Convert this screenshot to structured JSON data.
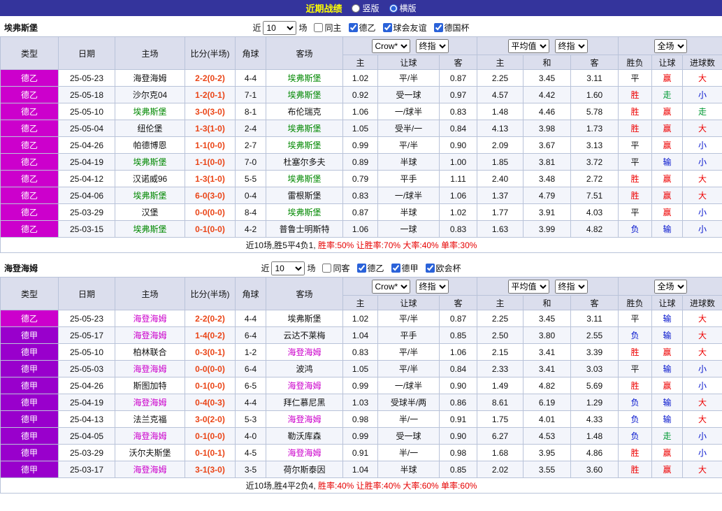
{
  "topbar": {
    "title": "近期战绩",
    "radios": [
      {
        "label": "竖版",
        "checked": false
      },
      {
        "label": "横版",
        "checked": true
      }
    ]
  },
  "league_colors": {
    "德乙": "#cc00cc",
    "德甲": "#9900cc"
  },
  "header_labels": {
    "col_type": "类型",
    "col_date": "日期",
    "col_home": "主场",
    "col_score": "比分(半场)",
    "col_corner": "角球",
    "col_away": "客场",
    "odds_sub": [
      "主",
      "让球",
      "客"
    ],
    "avg_sub": [
      "主",
      "和",
      "客"
    ],
    "result_sub": [
      "胜负",
      "让球",
      "进球数"
    ]
  },
  "sections": [
    {
      "team": "埃弗斯堡",
      "focal_color": "#008800",
      "filter": {
        "prefix": "近",
        "matches": "10",
        "suffix": "场",
        "checkboxes": [
          {
            "label": "同主",
            "checked": false
          },
          {
            "label": "德乙",
            "checked": true
          },
          {
            "label": "球会友谊",
            "checked": true
          },
          {
            "label": "德国杯",
            "checked": true
          }
        ]
      },
      "selects": {
        "bookmaker": "Crow*",
        "odds_stage": "终指",
        "average": "平均值",
        "avg_stage": "终指",
        "scope": "全场"
      },
      "rows": [
        {
          "league": "德乙",
          "date": "25-05-23",
          "home": "海登海姆",
          "home_focal": false,
          "score": "2-2(0-2)",
          "corner": "4-4",
          "away": "埃弗斯堡",
          "away_focal": true,
          "odds": [
            "1.02",
            "平/半",
            "0.87"
          ],
          "avg": [
            "2.25",
            "3.45",
            "3.11"
          ],
          "results": [
            "平",
            "赢",
            "大"
          ]
        },
        {
          "league": "德乙",
          "date": "25-05-18",
          "home": "沙尔克04",
          "home_focal": false,
          "score": "1-2(0-1)",
          "corner": "7-1",
          "away": "埃弗斯堡",
          "away_focal": true,
          "odds": [
            "0.92",
            "受一球",
            "0.97"
          ],
          "avg": [
            "4.57",
            "4.42",
            "1.60"
          ],
          "results": [
            "胜",
            "走",
            "小"
          ]
        },
        {
          "league": "德乙",
          "date": "25-05-10",
          "home": "埃弗斯堡",
          "home_focal": true,
          "score": "3-0(3-0)",
          "corner": "8-1",
          "away": "布伦瑞克",
          "away_focal": false,
          "odds": [
            "1.06",
            "一/球半",
            "0.83"
          ],
          "avg": [
            "1.48",
            "4.46",
            "5.78"
          ],
          "results": [
            "胜",
            "赢",
            "走"
          ]
        },
        {
          "league": "德乙",
          "date": "25-05-04",
          "home": "纽伦堡",
          "home_focal": false,
          "score": "1-3(1-0)",
          "corner": "2-4",
          "away": "埃弗斯堡",
          "away_focal": true,
          "odds": [
            "1.05",
            "受半/一",
            "0.84"
          ],
          "avg": [
            "4.13",
            "3.98",
            "1.73"
          ],
          "results": [
            "胜",
            "赢",
            "大"
          ]
        },
        {
          "league": "德乙",
          "date": "25-04-26",
          "home": "帕德博恩",
          "home_focal": false,
          "score": "1-1(0-0)",
          "corner": "2-7",
          "away": "埃弗斯堡",
          "away_focal": true,
          "odds": [
            "0.99",
            "平/半",
            "0.90"
          ],
          "avg": [
            "2.09",
            "3.67",
            "3.13"
          ],
          "results": [
            "平",
            "赢",
            "小"
          ]
        },
        {
          "league": "德乙",
          "date": "25-04-19",
          "home": "埃弗斯堡",
          "home_focal": true,
          "score": "1-1(0-0)",
          "corner": "7-0",
          "away": "杜塞尔多夫",
          "away_focal": false,
          "odds": [
            "0.89",
            "半球",
            "1.00"
          ],
          "avg": [
            "1.85",
            "3.81",
            "3.72"
          ],
          "results": [
            "平",
            "输",
            "小"
          ]
        },
        {
          "league": "德乙",
          "date": "25-04-12",
          "home": "汉诺威96",
          "home_focal": false,
          "score": "1-3(1-0)",
          "corner": "5-5",
          "away": "埃弗斯堡",
          "away_focal": true,
          "odds": [
            "0.79",
            "平手",
            "1.11"
          ],
          "avg": [
            "2.40",
            "3.48",
            "2.72"
          ],
          "results": [
            "胜",
            "赢",
            "大"
          ]
        },
        {
          "league": "德乙",
          "date": "25-04-06",
          "home": "埃弗斯堡",
          "home_focal": true,
          "score": "6-0(3-0)",
          "corner": "0-4",
          "away": "雷根斯堡",
          "away_focal": false,
          "odds": [
            "0.83",
            "一/球半",
            "1.06"
          ],
          "avg": [
            "1.37",
            "4.79",
            "7.51"
          ],
          "results": [
            "胜",
            "赢",
            "大"
          ]
        },
        {
          "league": "德乙",
          "date": "25-03-29",
          "home": "汉堡",
          "home_focal": false,
          "score": "0-0(0-0)",
          "corner": "8-4",
          "away": "埃弗斯堡",
          "away_focal": true,
          "odds": [
            "0.87",
            "半球",
            "1.02"
          ],
          "avg": [
            "1.77",
            "3.91",
            "4.03"
          ],
          "results": [
            "平",
            "赢",
            "小"
          ]
        },
        {
          "league": "德乙",
          "date": "25-03-15",
          "home": "埃弗斯堡",
          "home_focal": true,
          "score": "0-1(0-0)",
          "corner": "4-2",
          "away": "普鲁士明斯特",
          "away_focal": false,
          "odds": [
            "1.06",
            "一球",
            "0.83"
          ],
          "avg": [
            "1.63",
            "3.99",
            "4.82"
          ],
          "results": [
            "负",
            "输",
            "小"
          ]
        }
      ],
      "summary": {
        "prefix": "近10场,胜5平4负1, ",
        "stats": "胜率:50% 让胜率:70% 大率:40% 单率:30%"
      }
    },
    {
      "team": "海登海姆",
      "focal_color": "#cc00cc",
      "filter": {
        "prefix": "近",
        "matches": "10",
        "suffix": "场",
        "checkboxes": [
          {
            "label": "同客",
            "checked": false
          },
          {
            "label": "德乙",
            "checked": true
          },
          {
            "label": "德甲",
            "checked": true
          },
          {
            "label": "欧会杯",
            "checked": true
          }
        ]
      },
      "selects": {
        "bookmaker": "Crow*",
        "odds_stage": "终指",
        "average": "平均值",
        "avg_stage": "终指",
        "scope": "全场"
      },
      "rows": [
        {
          "league": "德乙",
          "date": "25-05-23",
          "home": "海登海姆",
          "home_focal": true,
          "score": "2-2(0-2)",
          "corner": "4-4",
          "away": "埃弗斯堡",
          "away_focal": false,
          "odds": [
            "1.02",
            "平/半",
            "0.87"
          ],
          "avg": [
            "2.25",
            "3.45",
            "3.11"
          ],
          "results": [
            "平",
            "输",
            "大"
          ]
        },
        {
          "league": "德甲",
          "date": "25-05-17",
          "home": "海登海姆",
          "home_focal": true,
          "score": "1-4(0-2)",
          "corner": "6-4",
          "away": "云达不莱梅",
          "away_focal": false,
          "odds": [
            "1.04",
            "平手",
            "0.85"
          ],
          "avg": [
            "2.50",
            "3.80",
            "2.55"
          ],
          "results": [
            "负",
            "输",
            "大"
          ]
        },
        {
          "league": "德甲",
          "date": "25-05-10",
          "home": "柏林联合",
          "home_focal": false,
          "score": "0-3(0-1)",
          "corner": "1-2",
          "away": "海登海姆",
          "away_focal": true,
          "odds": [
            "0.83",
            "平/半",
            "1.06"
          ],
          "avg": [
            "2.15",
            "3.41",
            "3.39"
          ],
          "results": [
            "胜",
            "赢",
            "大"
          ]
        },
        {
          "league": "德甲",
          "date": "25-05-03",
          "home": "海登海姆",
          "home_focal": true,
          "score": "0-0(0-0)",
          "corner": "6-4",
          "away": "波鸿",
          "away_focal": false,
          "odds": [
            "1.05",
            "平/半",
            "0.84"
          ],
          "avg": [
            "2.33",
            "3.41",
            "3.03"
          ],
          "results": [
            "平",
            "输",
            "小"
          ]
        },
        {
          "league": "德甲",
          "date": "25-04-26",
          "home": "斯图加特",
          "home_focal": false,
          "score": "0-1(0-0)",
          "corner": "6-5",
          "away": "海登海姆",
          "away_focal": true,
          "odds": [
            "0.99",
            "一/球半",
            "0.90"
          ],
          "avg": [
            "1.49",
            "4.82",
            "5.69"
          ],
          "results": [
            "胜",
            "赢",
            "小"
          ]
        },
        {
          "league": "德甲",
          "date": "25-04-19",
          "home": "海登海姆",
          "home_focal": true,
          "score": "0-4(0-3)",
          "corner": "4-4",
          "away": "拜仁慕尼黑",
          "away_focal": false,
          "odds": [
            "1.03",
            "受球半/两",
            "0.86"
          ],
          "avg": [
            "8.61",
            "6.19",
            "1.29"
          ],
          "results": [
            "负",
            "输",
            "大"
          ]
        },
        {
          "league": "德甲",
          "date": "25-04-13",
          "home": "法兰克福",
          "home_focal": false,
          "score": "3-0(2-0)",
          "corner": "5-3",
          "away": "海登海姆",
          "away_focal": true,
          "odds": [
            "0.98",
            "半/一",
            "0.91"
          ],
          "avg": [
            "1.75",
            "4.01",
            "4.33"
          ],
          "results": [
            "负",
            "输",
            "大"
          ]
        },
        {
          "league": "德甲",
          "date": "25-04-05",
          "home": "海登海姆",
          "home_focal": true,
          "score": "0-1(0-0)",
          "corner": "4-0",
          "away": "勒沃库森",
          "away_focal": false,
          "odds": [
            "0.99",
            "受一球",
            "0.90"
          ],
          "avg": [
            "6.27",
            "4.53",
            "1.48"
          ],
          "results": [
            "负",
            "走",
            "小"
          ]
        },
        {
          "league": "德甲",
          "date": "25-03-29",
          "home": "沃尔夫斯堡",
          "home_focal": false,
          "score": "0-1(0-1)",
          "corner": "4-5",
          "away": "海登海姆",
          "away_focal": true,
          "odds": [
            "0.91",
            "半/一",
            "0.98"
          ],
          "avg": [
            "1.68",
            "3.95",
            "4.86"
          ],
          "results": [
            "胜",
            "赢",
            "小"
          ]
        },
        {
          "league": "德甲",
          "date": "25-03-17",
          "home": "海登海姆",
          "home_focal": true,
          "score": "3-1(3-0)",
          "corner": "3-5",
          "away": "荷尔斯泰因",
          "away_focal": false,
          "odds": [
            "1.04",
            "半球",
            "0.85"
          ],
          "avg": [
            "2.02",
            "3.55",
            "3.60"
          ],
          "results": [
            "胜",
            "赢",
            "大"
          ]
        }
      ],
      "summary": {
        "prefix": "近10场,胜4平2负4, ",
        "stats": "胜率:40% 让胜率:40% 大率:60% 单率:60%"
      }
    }
  ]
}
